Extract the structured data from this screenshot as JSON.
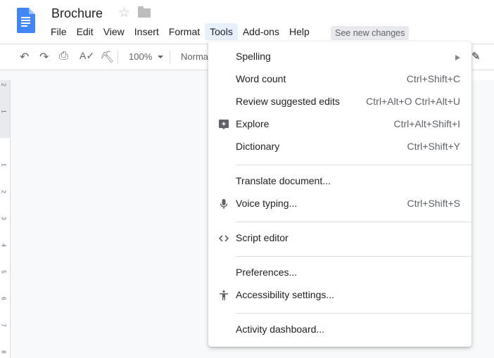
{
  "document": {
    "title": "Brochure"
  },
  "menubar": {
    "items": [
      "File",
      "Edit",
      "View",
      "Insert",
      "Format",
      "Tools",
      "Add-ons",
      "Help"
    ],
    "active": "Tools",
    "see_new_changes": "See new changes"
  },
  "toolbar": {
    "zoom": "100%",
    "style": "Normal"
  },
  "ruler": {
    "vertical_labels": [
      "2",
      "1",
      "1",
      "2",
      "3",
      "4",
      "5",
      "6",
      "7",
      "8"
    ]
  },
  "tools_menu": {
    "items": [
      {
        "label": "Spelling",
        "shortcut": "",
        "submenu": true,
        "icon": ""
      },
      {
        "label": "Word count",
        "shortcut": "Ctrl+Shift+C",
        "icon": ""
      },
      {
        "label": "Review suggested edits",
        "shortcut": "Ctrl+Alt+O Ctrl+Alt+U",
        "icon": ""
      },
      {
        "label": "Explore",
        "shortcut": "Ctrl+Alt+Shift+I",
        "icon": "explore-icon"
      },
      {
        "label": "Dictionary",
        "shortcut": "Ctrl+Shift+Y",
        "icon": ""
      },
      {
        "label": "Translate document...",
        "shortcut": "",
        "icon": ""
      },
      {
        "label": "Voice typing...",
        "shortcut": "Ctrl+Shift+S",
        "icon": "microphone-icon"
      },
      {
        "label": "Script editor",
        "shortcut": "",
        "icon": "code-icon"
      },
      {
        "label": "Preferences...",
        "shortcut": "",
        "icon": ""
      },
      {
        "label": "Accessibility settings...",
        "shortcut": "",
        "icon": "accessibility-icon"
      },
      {
        "label": "Activity dashboard...",
        "shortcut": "",
        "icon": ""
      }
    ]
  }
}
